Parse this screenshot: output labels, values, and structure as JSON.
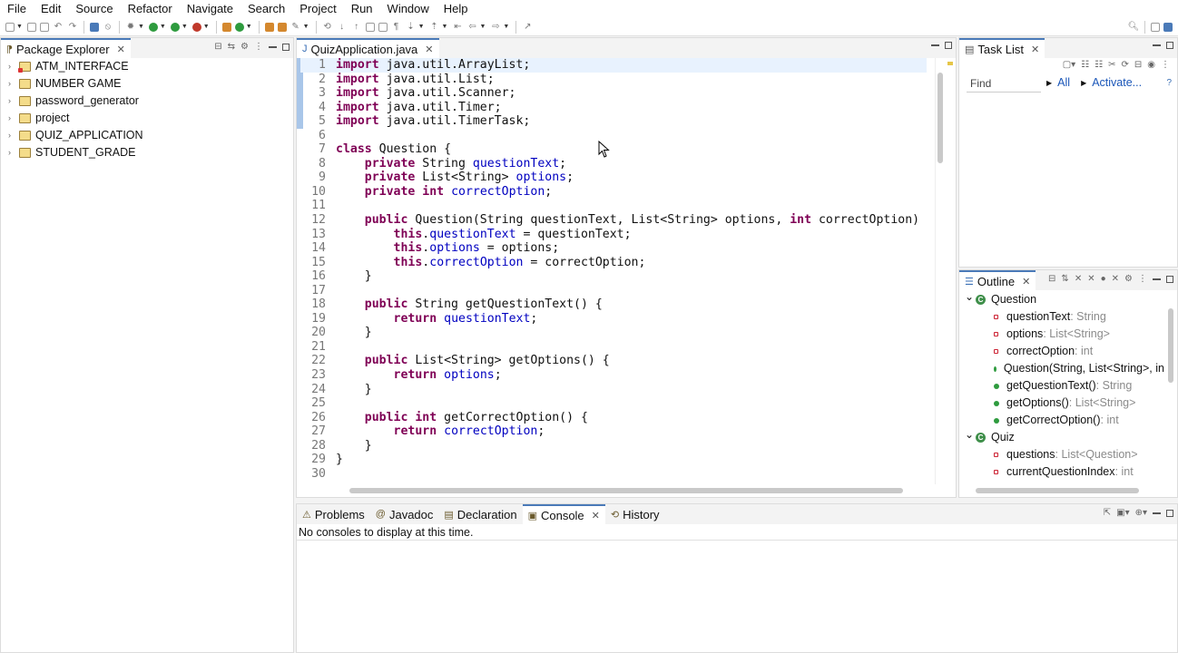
{
  "menu": [
    "File",
    "Edit",
    "Source",
    "Refactor",
    "Navigate",
    "Search",
    "Project",
    "Run",
    "Window",
    "Help"
  ],
  "package_explorer": {
    "title": "Package Explorer",
    "projects": [
      "ATM_INTERFACE",
      "NUMBER GAME",
      "password_generator",
      "project",
      "QUIZ_APPLICATION",
      "STUDENT_GRADE"
    ]
  },
  "editor": {
    "tab": "QuizApplication.java",
    "lines": [
      {
        "n": "1",
        "fold": "⊖",
        "parts": [
          [
            "kw",
            "import"
          ],
          [
            "",
            " java.util.ArrayList;"
          ]
        ]
      },
      {
        "n": "2",
        "parts": [
          [
            "kw",
            "import"
          ],
          [
            "",
            " java.util.List;"
          ]
        ]
      },
      {
        "n": "3",
        "parts": [
          [
            "kw",
            "import"
          ],
          [
            "",
            " java.util.Scanner;"
          ]
        ]
      },
      {
        "n": "4",
        "parts": [
          [
            "kw",
            "import"
          ],
          [
            "",
            " java.util.Timer;"
          ]
        ]
      },
      {
        "n": "5",
        "parts": [
          [
            "kw",
            "import"
          ],
          [
            "",
            " java.util.TimerTask;"
          ]
        ]
      },
      {
        "n": "6",
        "parts": []
      },
      {
        "n": "7",
        "parts": [
          [
            "kw",
            "class"
          ],
          [
            "",
            " Question {"
          ]
        ]
      },
      {
        "n": "8",
        "parts": [
          [
            "",
            "    "
          ],
          [
            "kw",
            "private"
          ],
          [
            "",
            " String "
          ],
          [
            "fld",
            "questionText"
          ],
          [
            "",
            ";"
          ]
        ]
      },
      {
        "n": "9",
        "parts": [
          [
            "",
            "    "
          ],
          [
            "kw",
            "private"
          ],
          [
            "",
            " List<String> "
          ],
          [
            "fld",
            "options"
          ],
          [
            "",
            ";"
          ]
        ]
      },
      {
        "n": "10",
        "parts": [
          [
            "",
            "    "
          ],
          [
            "kw",
            "private"
          ],
          [
            "",
            " "
          ],
          [
            "kw",
            "int"
          ],
          [
            "",
            " "
          ],
          [
            "fld",
            "correctOption"
          ],
          [
            "",
            ";"
          ]
        ]
      },
      {
        "n": "11",
        "parts": []
      },
      {
        "n": "12",
        "fold": "⊖",
        "parts": [
          [
            "",
            "    "
          ],
          [
            "kw",
            "public"
          ],
          [
            "",
            " Question(String questionText, List<String> options, "
          ],
          [
            "kw",
            "int"
          ],
          [
            "",
            " correctOption)"
          ]
        ]
      },
      {
        "n": "13",
        "parts": [
          [
            "",
            "        "
          ],
          [
            "kw",
            "this"
          ],
          [
            "",
            "."
          ],
          [
            "fld",
            "questionText"
          ],
          [
            "",
            " = questionText;"
          ]
        ]
      },
      {
        "n": "14",
        "parts": [
          [
            "",
            "        "
          ],
          [
            "kw",
            "this"
          ],
          [
            "",
            "."
          ],
          [
            "fld",
            "options"
          ],
          [
            "",
            " = options;"
          ]
        ]
      },
      {
        "n": "15",
        "parts": [
          [
            "",
            "        "
          ],
          [
            "kw",
            "this"
          ],
          [
            "",
            "."
          ],
          [
            "fld",
            "correctOption"
          ],
          [
            "",
            " = correctOption;"
          ]
        ]
      },
      {
        "n": "16",
        "parts": [
          [
            "",
            "    }"
          ]
        ]
      },
      {
        "n": "17",
        "parts": []
      },
      {
        "n": "18",
        "fold": "⊖",
        "parts": [
          [
            "",
            "    "
          ],
          [
            "kw",
            "public"
          ],
          [
            "",
            " String getQuestionText() {"
          ]
        ]
      },
      {
        "n": "19",
        "parts": [
          [
            "",
            "        "
          ],
          [
            "kw",
            "return"
          ],
          [
            "",
            " "
          ],
          [
            "fld",
            "questionText"
          ],
          [
            "",
            ";"
          ]
        ]
      },
      {
        "n": "20",
        "parts": [
          [
            "",
            "    }"
          ]
        ]
      },
      {
        "n": "21",
        "parts": []
      },
      {
        "n": "22",
        "fold": "⊖",
        "parts": [
          [
            "",
            "    "
          ],
          [
            "kw",
            "public"
          ],
          [
            "",
            " List<String> getOptions() {"
          ]
        ]
      },
      {
        "n": "23",
        "parts": [
          [
            "",
            "        "
          ],
          [
            "kw",
            "return"
          ],
          [
            "",
            " "
          ],
          [
            "fld",
            "options"
          ],
          [
            "",
            ";"
          ]
        ]
      },
      {
        "n": "24",
        "parts": [
          [
            "",
            "    }"
          ]
        ]
      },
      {
        "n": "25",
        "parts": []
      },
      {
        "n": "26",
        "fold": "⊖",
        "parts": [
          [
            "",
            "    "
          ],
          [
            "kw",
            "public"
          ],
          [
            "",
            " "
          ],
          [
            "kw",
            "int"
          ],
          [
            "",
            " getCorrectOption() {"
          ]
        ]
      },
      {
        "n": "27",
        "parts": [
          [
            "",
            "        "
          ],
          [
            "kw",
            "return"
          ],
          [
            "",
            " "
          ],
          [
            "fld",
            "correctOption"
          ],
          [
            "",
            ";"
          ]
        ]
      },
      {
        "n": "28",
        "parts": [
          [
            "",
            "    }"
          ]
        ]
      },
      {
        "n": "29",
        "parts": [
          [
            "",
            "}"
          ]
        ]
      },
      {
        "n": "30",
        "parts": []
      }
    ]
  },
  "task_list": {
    "title": "Task List",
    "find_placeholder": "Find",
    "all_label": "All",
    "activate_label": "Activate..."
  },
  "outline": {
    "title": "Outline",
    "items": [
      {
        "kind": "class",
        "name": "Question",
        "type": ""
      },
      {
        "kind": "field",
        "name": "questionText",
        "type": " : String"
      },
      {
        "kind": "field",
        "name": "options",
        "type": " : List<String>"
      },
      {
        "kind": "field",
        "name": "correctOption",
        "type": " : int"
      },
      {
        "kind": "ctor",
        "name": "Question(String, List<String>, in",
        "type": ""
      },
      {
        "kind": "method",
        "name": "getQuestionText()",
        "type": " : String"
      },
      {
        "kind": "method",
        "name": "getOptions()",
        "type": " : List<String>"
      },
      {
        "kind": "method",
        "name": "getCorrectOption()",
        "type": " : int"
      },
      {
        "kind": "class",
        "name": "Quiz",
        "type": ""
      },
      {
        "kind": "field",
        "name": "questions",
        "type": " : List<Question>"
      },
      {
        "kind": "field",
        "name": "currentQuestionIndex",
        "type": " : int"
      }
    ]
  },
  "bottom": {
    "tabs": [
      "Problems",
      "Javadoc",
      "Declaration",
      "Console",
      "History"
    ],
    "active": "Console",
    "message": "No consoles to display at this time."
  }
}
